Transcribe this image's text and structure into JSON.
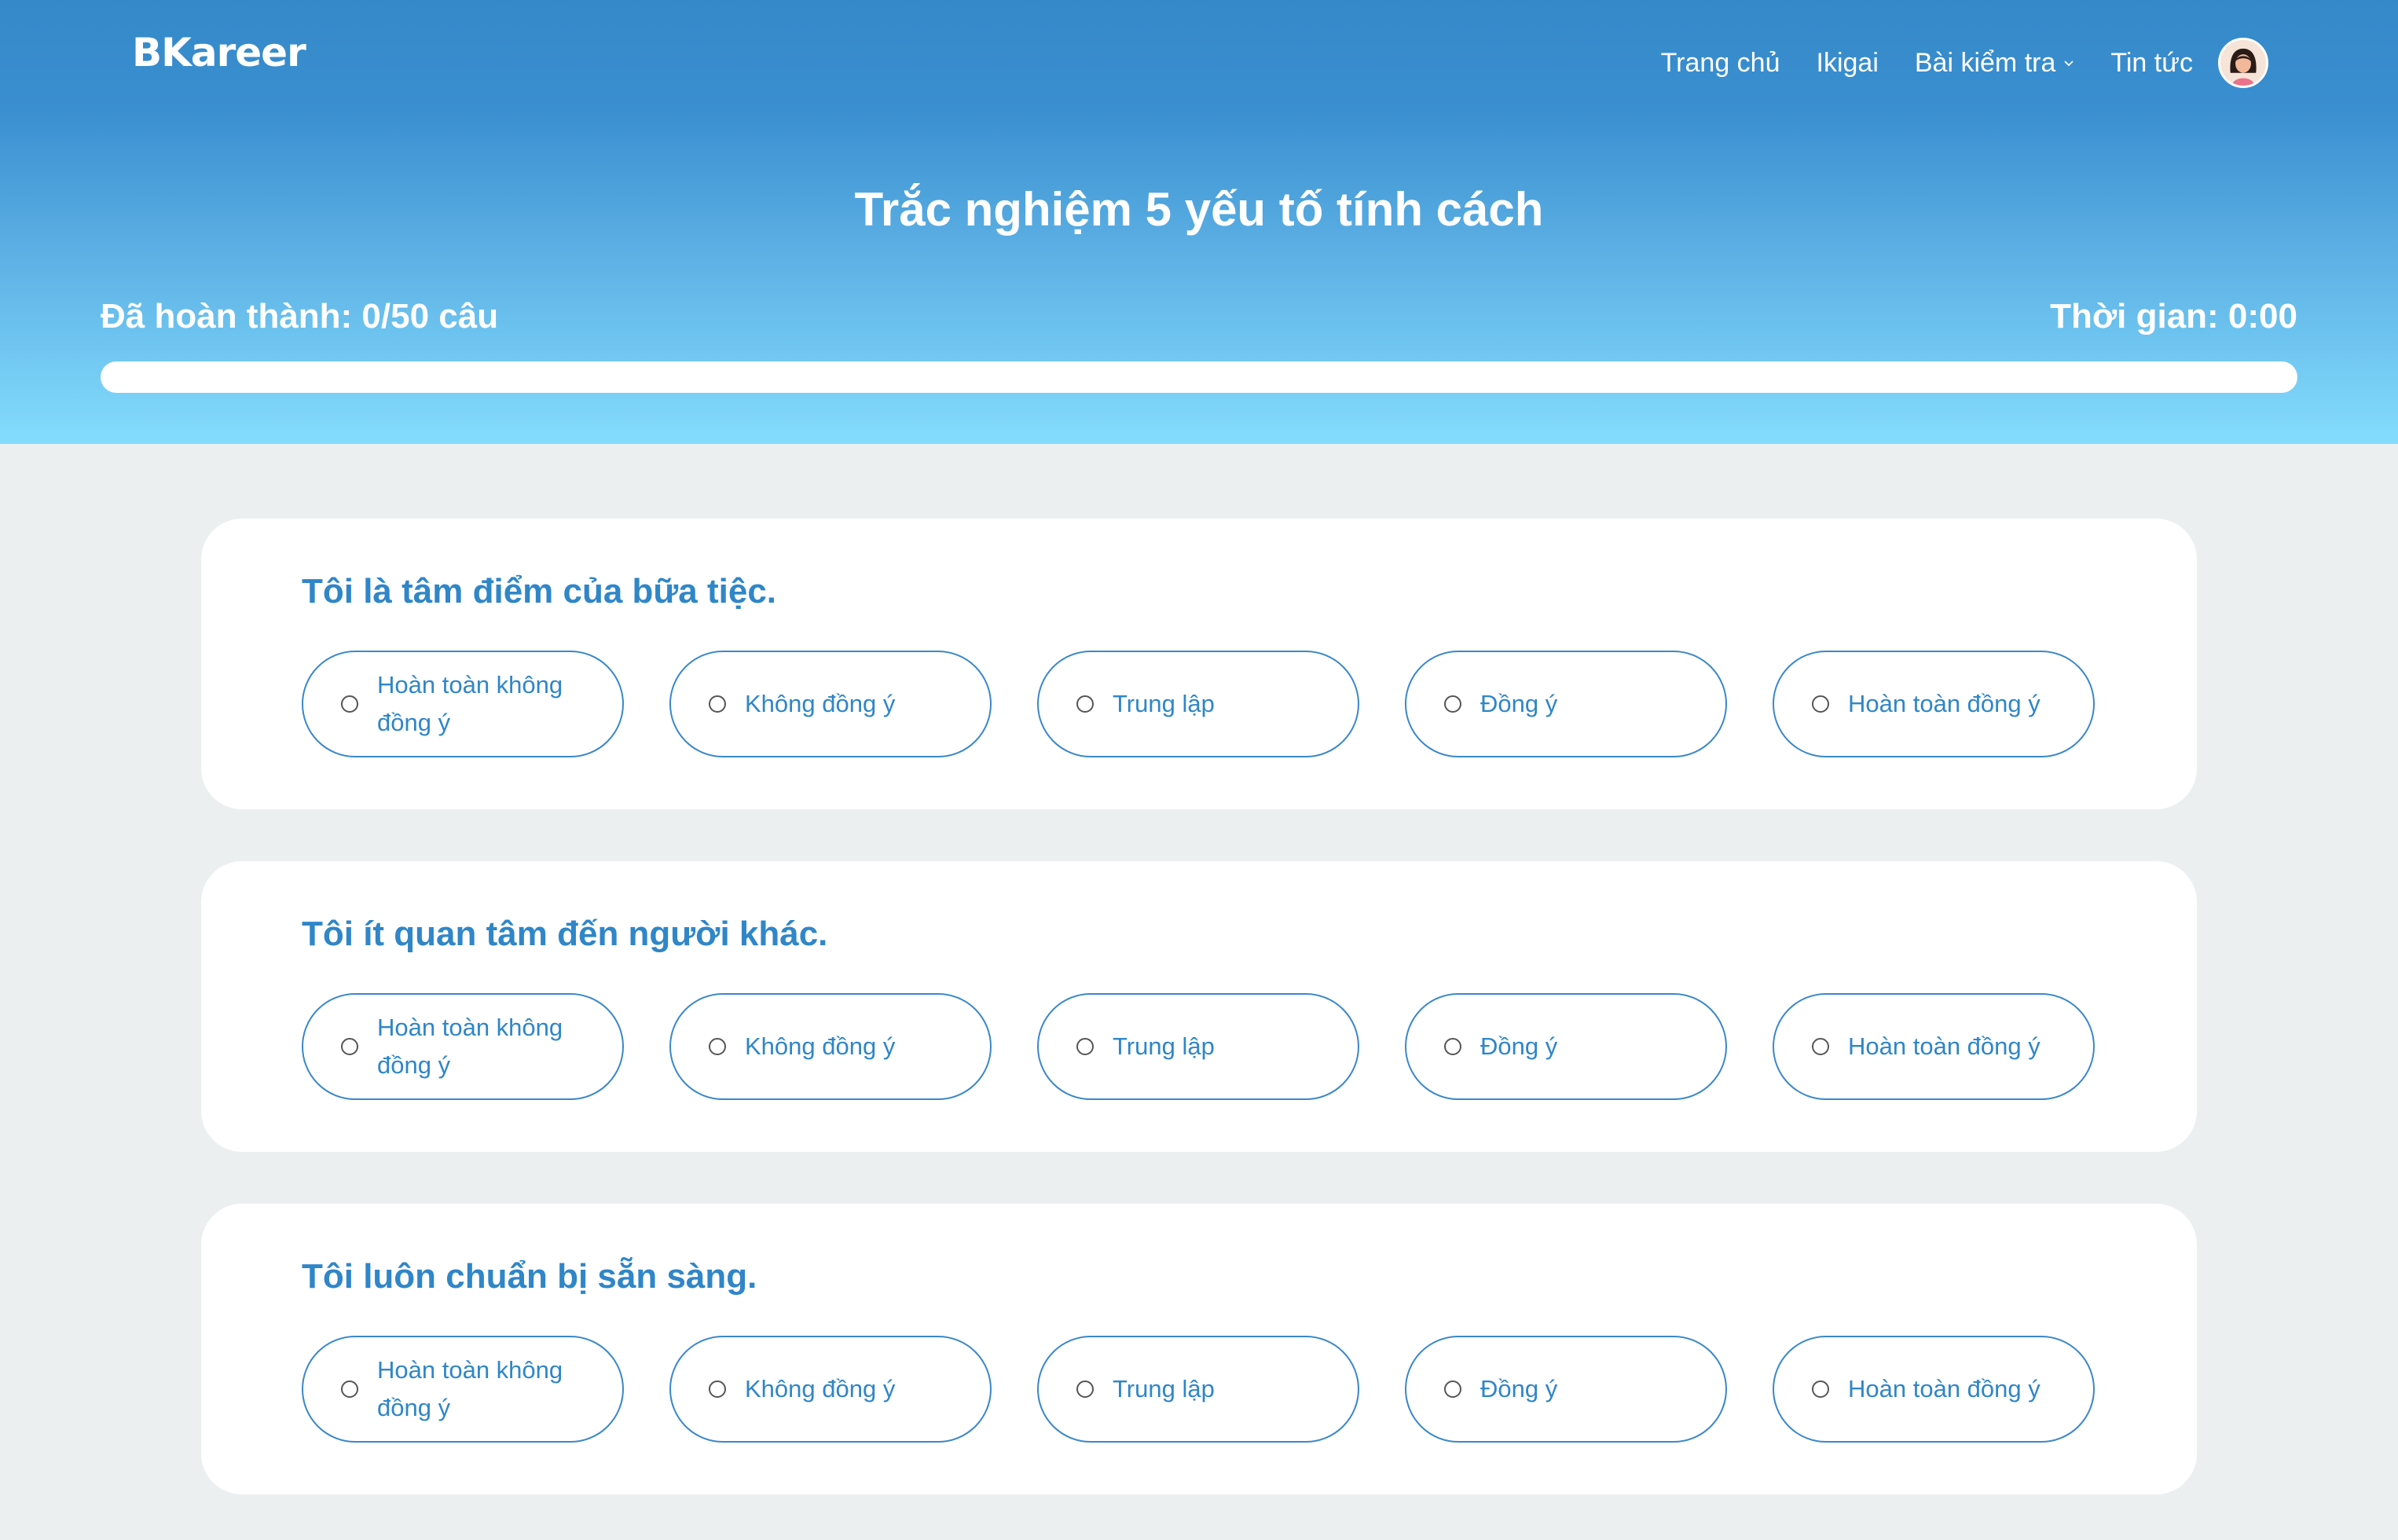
{
  "app": {
    "brand": "BKareer"
  },
  "nav": {
    "items": [
      {
        "label": "Trang chủ"
      },
      {
        "label": "Ikigai"
      },
      {
        "label": "Bài kiểm tra",
        "has_dropdown": true
      },
      {
        "label": "Tin tức"
      }
    ],
    "avatar_icon": "user-avatar-icon"
  },
  "quiz": {
    "title": "Trắc nghiệm 5 yếu tố tính cách",
    "progress_text": "Đã hoàn thành: 0/50 câu",
    "timer_text": "Thời gian: 0:00",
    "progress_fraction": 0
  },
  "questions": [
    {
      "text": "Tôi là tâm điểm của bữa tiệc.",
      "options": [
        "Hoàn toàn không đồng ý",
        "Không đồng ý",
        "Trung lập",
        "Đồng ý",
        "Hoàn toàn đồng ý"
      ]
    },
    {
      "text": "Tôi ít quan tâm đến người khác.",
      "options": [
        "Hoàn toàn không đồng ý",
        "Không đồng ý",
        "Trung lập",
        "Đồng ý",
        "Hoàn toàn đồng ý"
      ]
    },
    {
      "text": "Tôi luôn chuẩn bị sẵn sàng.",
      "options": [
        "Hoàn toàn không đồng ý",
        "Không đồng ý",
        "Trung lập",
        "Đồng ý",
        "Hoàn toàn đồng ý"
      ]
    }
  ],
  "colors": {
    "accent": "#2F86C8",
    "header_top": "#3589C9",
    "header_bottom": "#84DCFD",
    "background": "#ECEFF0"
  }
}
